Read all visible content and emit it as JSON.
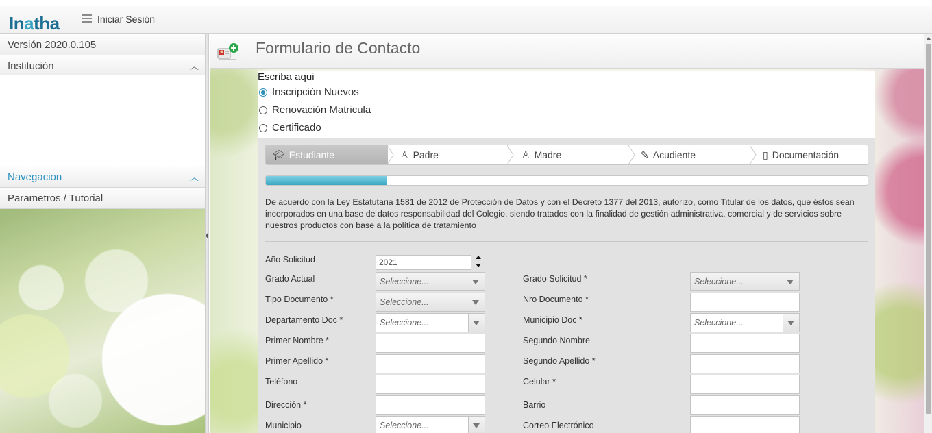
{
  "header": {
    "logo_text_1": "In",
    "logo_text_2": "a",
    "logo_text_3": "tha",
    "login_label": "Iniciar Sesión"
  },
  "sidebar": {
    "version": "Versión 2020.0.105",
    "institution": "Institución",
    "navigation": "Navegacion",
    "tutorial": "Parametros / Tutorial"
  },
  "page": {
    "title": "Formulario de Contacto"
  },
  "radio_group": {
    "title": "Escriba aqui",
    "options": [
      "Inscripción Nuevos",
      "Renovación Matricula",
      "Certificado"
    ],
    "selected": "Inscripción Nuevos"
  },
  "wizard": {
    "steps": [
      "Estudiante",
      "Padre",
      "Madre",
      "Acudiente",
      "Documentación"
    ],
    "active_step": "Estudiante",
    "progress": 0.2
  },
  "consent_text": "De acuerdo con la Ley Estatutaria 1581 de 2012 de Protección de Datos y con el Decreto 1377 del 2013, autorizo, como Titular de los datos, que éstos sean incorporados en una base de datos responsabilidad del Colegio, siendo tratados con la finalidad de gestión administrativa, comercial y de servicios sobre nuestros productos con base a la política de tratamiento",
  "form": {
    "ano_solicitud_label": "Año Solicitud",
    "ano_solicitud_value": "2021",
    "grado_actual_label": "Grado Actual",
    "grado_solicitud_label": "Grado Solicitud *",
    "tipo_documento_label": "Tipo Documento *",
    "nro_documento_label": "Nro Documento *",
    "departamento_label": "Departamento Doc *",
    "municipio_doc_label": "Municipio Doc *",
    "primer_nombre_label": "Primer Nombre *",
    "segundo_nombre_label": "Segundo Nombre",
    "primer_apellido_label": "Primer Apellido *",
    "segundo_apellido_label": "Segundo Apellido *",
    "telefono_label": "Teléfono",
    "celular_label": "Celular *",
    "direccion_label": "Dirección *",
    "barrio_label": "Barrio",
    "municipio_label": "Municipio",
    "correo_label": "Correo Electrónico",
    "select_placeholder": "Seleccione..."
  },
  "colors": {
    "accent": "#2a92c0",
    "progress": "#3aa7c2",
    "logo": "#1d6f93"
  },
  "icons": {
    "menu": "hamburger-icon",
    "form": "add-contact-icon",
    "estudiante": "graduation-cap-icon",
    "padre": "user-icon",
    "madre": "user-icon",
    "acudiente": "pencil-icon",
    "documentacion": "document-icon"
  }
}
